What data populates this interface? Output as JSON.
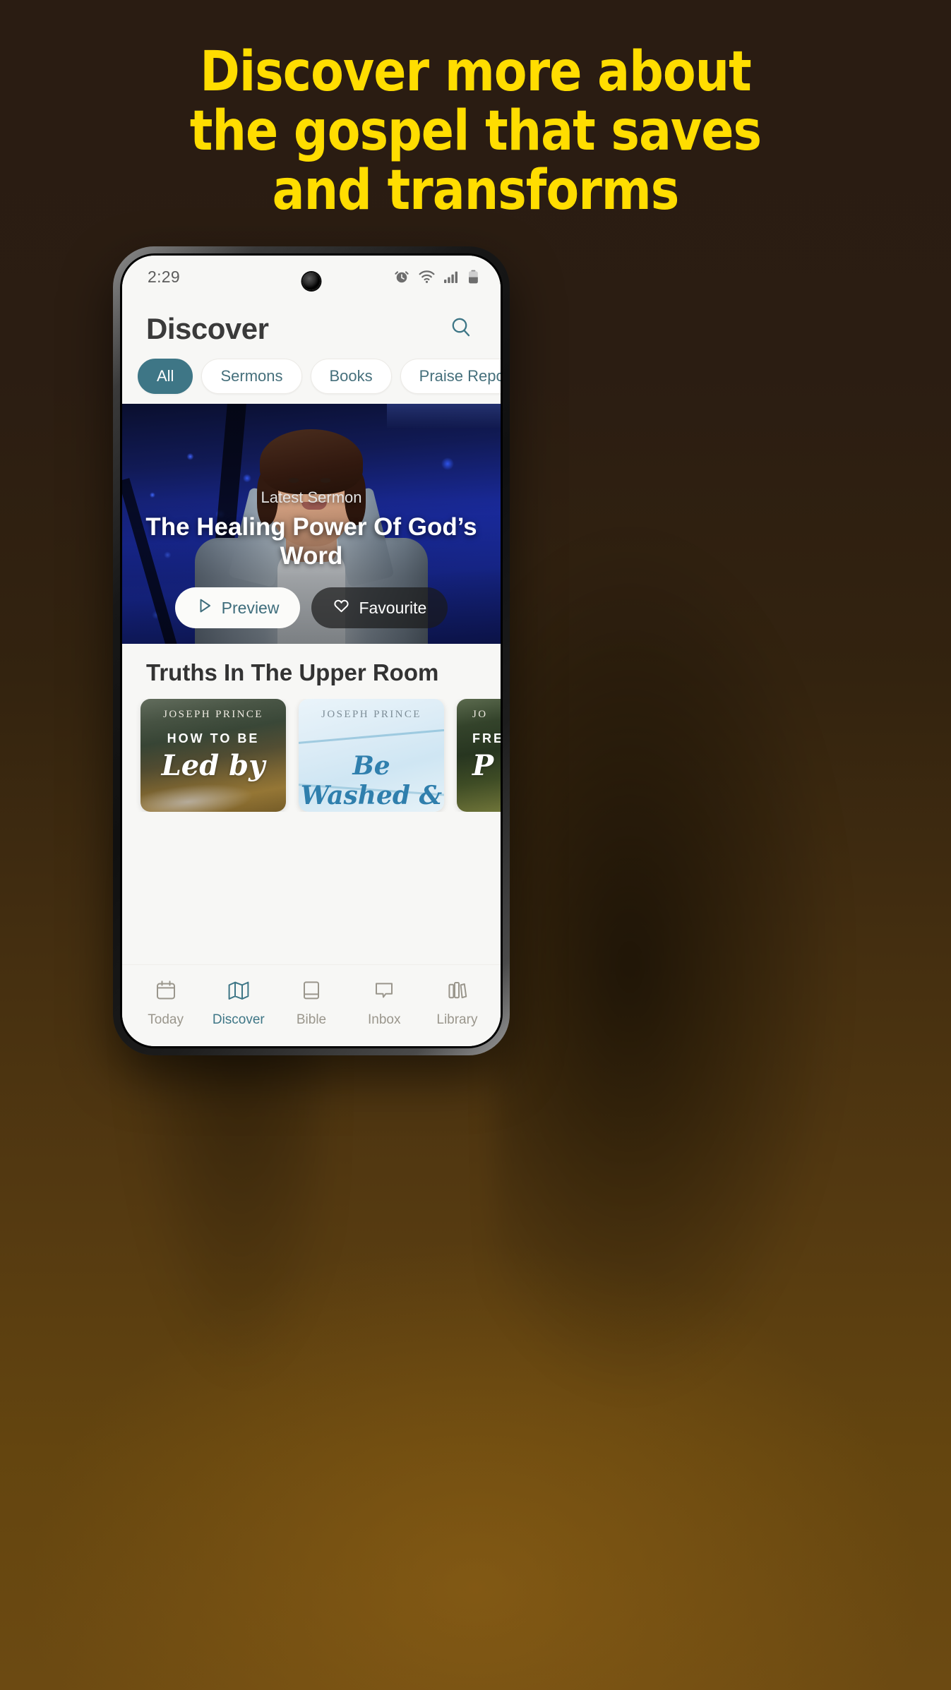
{
  "promo": {
    "headline_lines": [
      "Discover more about",
      "the gospel that saves",
      "and transforms"
    ],
    "headline_color": "#FFDD00",
    "background_top_color": "#2a1c12",
    "background_bottom_color": "#6c4a12"
  },
  "statusbar": {
    "time": "2:29",
    "icons": [
      "alarm-icon",
      "wifi-icon",
      "cellular-signal-icon",
      "battery-icon"
    ],
    "camera": "front-camera-punch-hole"
  },
  "header": {
    "title": "Discover",
    "search_icon": "search-icon",
    "accent_color": "#3e7686"
  },
  "filters": {
    "chips": [
      {
        "label": "All",
        "active": true
      },
      {
        "label": "Sermons",
        "active": false
      },
      {
        "label": "Books",
        "active": false
      },
      {
        "label": "Praise Reports",
        "active": false
      }
    ]
  },
  "hero": {
    "eyebrow": "Latest Sermon",
    "title": "The Healing Power Of God’s Word",
    "preview_label": "Preview",
    "preview_icon": "play-icon",
    "favourite_label": "Favourite",
    "favourite_icon": "heart-icon"
  },
  "section": {
    "title": "Truths In The Upper Room",
    "cards": [
      {
        "author": "JOSEPH PRINCE",
        "kicker": "HOW TO BE",
        "script": "Led by"
      },
      {
        "author": "JOSEPH PRINCE",
        "kicker": "",
        "script": "Be Washed & Refreshed"
      },
      {
        "author": "JO",
        "kicker": "FRE",
        "script": "P"
      }
    ]
  },
  "tabbar": {
    "items": [
      {
        "label": "Today",
        "icon": "calendar-icon",
        "active": false
      },
      {
        "label": "Discover",
        "icon": "map-icon",
        "active": true
      },
      {
        "label": "Bible",
        "icon": "book-icon",
        "active": false
      },
      {
        "label": "Inbox",
        "icon": "speech-bubble-icon",
        "active": false
      },
      {
        "label": "Library",
        "icon": "books-shelf-icon",
        "active": false
      }
    ],
    "active_color": "#3e7686",
    "inactive_color": "#9a968c"
  }
}
